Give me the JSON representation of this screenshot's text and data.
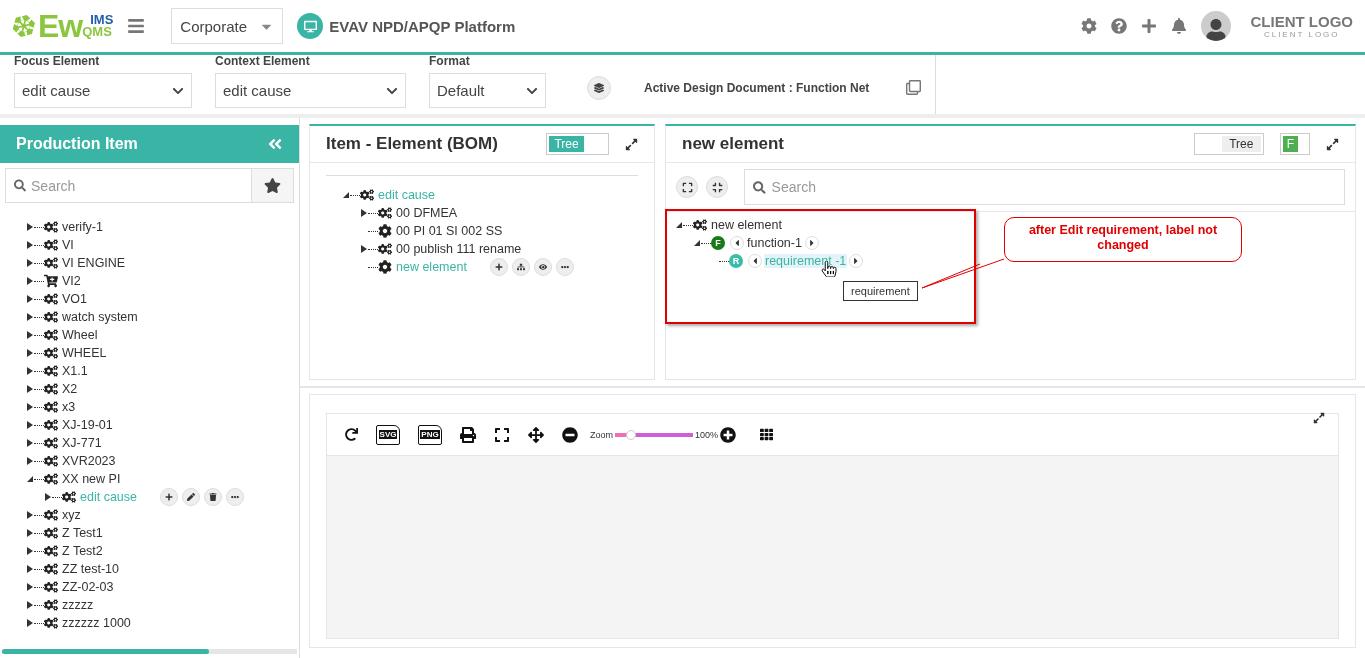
{
  "header": {
    "logo": {
      "main": "Ew",
      "top": "IMS",
      "bottom": "QMS"
    },
    "org_select": {
      "value": "Corporate"
    },
    "platform_title": "EVAV NPD/APQP Platform",
    "client_logo": {
      "title": "CLIENT LOGO",
      "subtitle": "CLIENT LOGO"
    }
  },
  "filters": {
    "fields": [
      {
        "label": "Focus Element",
        "value": "edit cause"
      },
      {
        "label": "Context Element",
        "value": "edit cause"
      },
      {
        "label": "Format",
        "value": "Default"
      }
    ],
    "active_document": "Active Design Document : Function Net"
  },
  "sidebar": {
    "title": "Production Item",
    "search": {
      "placeholder": "Search"
    },
    "tree": [
      {
        "label": "verify-1",
        "kind": "gears",
        "leaf": false,
        "expanded": false,
        "selected": false,
        "hovered": false
      },
      {
        "label": "VI",
        "kind": "gears",
        "leaf": false,
        "expanded": false,
        "selected": false,
        "hovered": false
      },
      {
        "label": "VI ENGINE",
        "kind": "gears",
        "leaf": false,
        "expanded": false,
        "selected": false,
        "hovered": false
      },
      {
        "label": "VI2",
        "kind": "cart",
        "leaf": false,
        "expanded": false,
        "selected": false,
        "hovered": false
      },
      {
        "label": "VO1",
        "kind": "gears",
        "leaf": false,
        "expanded": false,
        "selected": false,
        "hovered": false
      },
      {
        "label": "watch system",
        "kind": "gears",
        "leaf": false,
        "expanded": false,
        "selected": false,
        "hovered": false
      },
      {
        "label": "Wheel",
        "kind": "gears",
        "leaf": false,
        "expanded": false,
        "selected": false,
        "hovered": false
      },
      {
        "label": "WHEEL",
        "kind": "gears",
        "leaf": false,
        "expanded": false,
        "selected": false,
        "hovered": false
      },
      {
        "label": "X1.1",
        "kind": "gears",
        "leaf": false,
        "expanded": false,
        "selected": false,
        "hovered": false
      },
      {
        "label": "X2",
        "kind": "gears",
        "leaf": false,
        "expanded": false,
        "selected": false,
        "hovered": false
      },
      {
        "label": "x3",
        "kind": "gears",
        "leaf": false,
        "expanded": false,
        "selected": false,
        "hovered": false
      },
      {
        "label": "XJ-19-01",
        "kind": "gears",
        "leaf": false,
        "expanded": false,
        "selected": false,
        "hovered": false
      },
      {
        "label": "XJ-771",
        "kind": "gears",
        "leaf": false,
        "expanded": false,
        "selected": false,
        "hovered": false
      },
      {
        "label": "XVR2023",
        "kind": "gears",
        "leaf": false,
        "expanded": false,
        "selected": false,
        "hovered": false
      },
      {
        "label": "XX new PI",
        "kind": "gears",
        "leaf": false,
        "expanded": true,
        "selected": false,
        "hovered": false,
        "children": [
          {
            "label": "edit cause",
            "kind": "gears",
            "leaf": false,
            "expanded": false,
            "selected": true,
            "hovered": true
          }
        ]
      },
      {
        "label": "xyz",
        "kind": "gears",
        "leaf": false,
        "expanded": false,
        "selected": false,
        "hovered": false
      },
      {
        "label": "Z Test1",
        "kind": "gears",
        "leaf": false,
        "expanded": false,
        "selected": false,
        "hovered": false
      },
      {
        "label": "Z Test2",
        "kind": "gears",
        "leaf": false,
        "expanded": false,
        "selected": false,
        "hovered": false
      },
      {
        "label": "ZZ test-10",
        "kind": "gears",
        "leaf": false,
        "expanded": false,
        "selected": false,
        "hovered": false
      },
      {
        "label": "ZZ-02-03",
        "kind": "gears",
        "leaf": false,
        "expanded": false,
        "selected": false,
        "hovered": false
      },
      {
        "label": "zzzzz",
        "kind": "gears",
        "leaf": false,
        "expanded": false,
        "selected": false,
        "hovered": false
      },
      {
        "label": "zzzzzz 1000",
        "kind": "gears",
        "leaf": false,
        "expanded": false,
        "selected": false,
        "hovered": false
      }
    ]
  },
  "bom_panel": {
    "title": "Item - Element (BOM)",
    "toggle": {
      "label": "Tree",
      "on": true
    },
    "tree": [
      {
        "label": "edit cause",
        "kind": "gears",
        "leaf": false,
        "expanded": true,
        "selected": true,
        "hovered": false,
        "children": [
          {
            "label": "00 DFMEA",
            "kind": "gears",
            "leaf": false,
            "expanded": false,
            "selected": false,
            "hovered": false
          },
          {
            "label": "00 PI 01 SI 002 SS",
            "kind": "gear",
            "leaf": true,
            "selected": false,
            "hovered": false
          },
          {
            "label": "00 publish 111 rename",
            "kind": "gears",
            "leaf": false,
            "expanded": false,
            "selected": false,
            "hovered": false
          },
          {
            "label": "new element",
            "kind": "gear",
            "leaf": true,
            "selected": true,
            "hovered": true
          }
        ]
      }
    ]
  },
  "structure_panel": {
    "title": "new element",
    "toggles": [
      {
        "label": "Tree",
        "on": false
      },
      {
        "label": "F",
        "on": true
      }
    ],
    "search": {
      "placeholder": "Search"
    },
    "tree": [
      {
        "label": "new element",
        "kind": "gears",
        "leaf": false,
        "expanded": true,
        "selected": false,
        "children": [
          {
            "label": "function-1",
            "kind": "function",
            "badge": "F",
            "color": "#1a7a1a",
            "leaf": false,
            "expanded": true,
            "selected": false,
            "children": [
              {
                "label": "requirement -1",
                "kind": "requirement",
                "badge": "R",
                "color": "#3cbba9",
                "leaf": true,
                "selected": true
              }
            ]
          }
        ]
      }
    ],
    "tooltip": "requirement",
    "annotation": "after Edit requirement, label not changed"
  },
  "diagram_panel": {
    "export_buttons": [
      "SVG",
      "PNG"
    ],
    "zoom": {
      "label": "Zoom",
      "level": 0.2,
      "reading": "100%"
    }
  }
}
